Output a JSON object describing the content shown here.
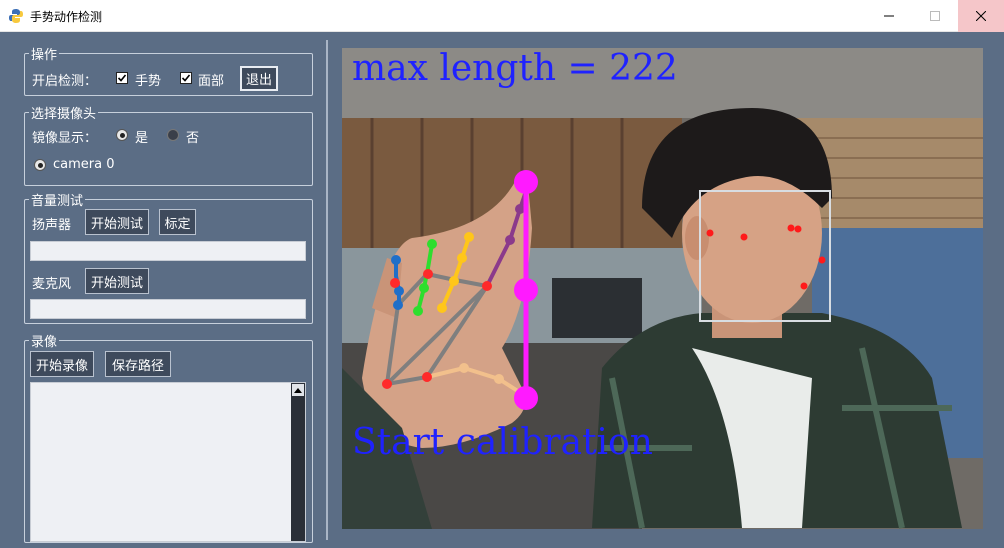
{
  "window": {
    "title": "手势动作检测"
  },
  "ops": {
    "legend": "操作",
    "enable_label": "开启检测：",
    "gesture_label": "手势",
    "face_label": "面部",
    "exit_label": "退出"
  },
  "camera_select": {
    "legend": "选择摄像头",
    "mirror_label": "镜像显示：",
    "yes_label": "是",
    "no_label": "否",
    "camera_option": "camera 0"
  },
  "volume": {
    "legend": "音量测试",
    "speaker_label": "扬声器",
    "speaker_test_label": "开始测试",
    "calibrate_label": "标定",
    "mic_label": "麦克风",
    "mic_test_label": "开始测试"
  },
  "record": {
    "legend": "录像",
    "start_label": "开始录像",
    "save_path_label": "保存路径"
  },
  "overlay": {
    "max_length_text": "max length = 222",
    "calibration_text": "Start calibration"
  },
  "colors": {
    "overlay_text": "#1f22ff",
    "measure": "#ff1aff",
    "panel_bg": "#5b6d85"
  }
}
